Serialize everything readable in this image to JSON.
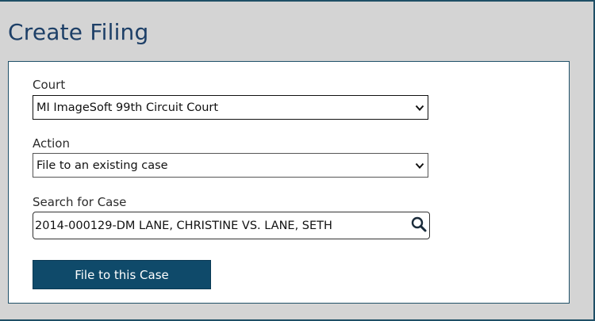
{
  "page": {
    "title": "Create Filing"
  },
  "form": {
    "court": {
      "label": "Court",
      "value": "MI ImageSoft 99th Circuit Court"
    },
    "action": {
      "label": "Action",
      "value": "File to an existing case"
    },
    "case_search": {
      "label": "Search for Case",
      "value": "2014-000129-DM LANE, CHRISTINE VS. LANE, SETH"
    },
    "submit_label": "File to this Case"
  },
  "colors": {
    "background": "#d4d4d4",
    "title": "#1d3f67",
    "accent": "#0f4a6a",
    "panel_border": "#1f5068"
  },
  "icons": {
    "dropdown": "chevron-down-icon",
    "search": "search-icon"
  }
}
